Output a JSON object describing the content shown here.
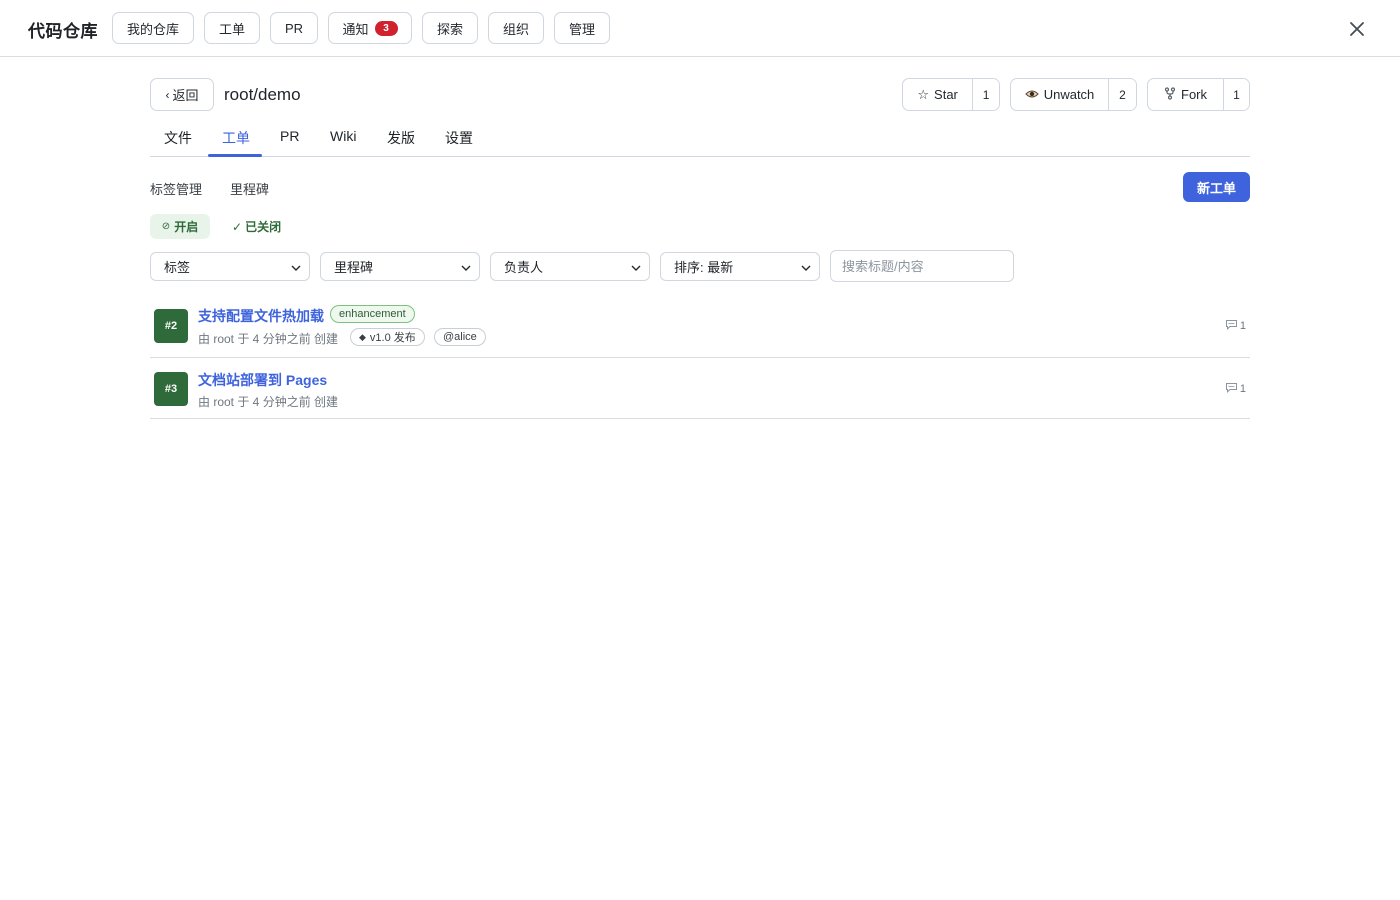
{
  "app": {
    "brand": "代码仓库",
    "nav": [
      {
        "label": "我的仓库"
      },
      {
        "label": "工单"
      },
      {
        "label": "PR"
      },
      {
        "label": "通知",
        "badge": "3"
      },
      {
        "label": "探索"
      },
      {
        "label": "组织"
      },
      {
        "label": "管理"
      }
    ]
  },
  "repo": {
    "back_label": "返回",
    "title": "root/demo",
    "star": {
      "label": "Star",
      "count": "1"
    },
    "watch": {
      "label": "Unwatch",
      "count": "2"
    },
    "fork": {
      "label": "Fork",
      "count": "1"
    }
  },
  "tabs": [
    {
      "label": "文件"
    },
    {
      "label": "工单",
      "active": true
    },
    {
      "label": "PR"
    },
    {
      "label": "Wiki"
    },
    {
      "label": "发版"
    },
    {
      "label": "设置"
    }
  ],
  "subnav": {
    "labels_link": "标签管理",
    "milestones_link": "里程碑",
    "new_issue": "新工单"
  },
  "state_filter": {
    "open": "开启",
    "closed": "已关闭"
  },
  "filters": {
    "label": "标签",
    "milestone": "里程碑",
    "assignee": "负责人",
    "sort": "排序: 最新",
    "search_placeholder": "搜索标题/内容"
  },
  "issues": [
    {
      "number": "#2",
      "title": "支持配置文件热加载",
      "label": "enhancement",
      "meta": "由 root 于 4 分钟之前 创建",
      "milestone": "v1.0 发布",
      "assignee": "@alice",
      "comments": "1"
    },
    {
      "number": "#3",
      "title": "文档站部署到 Pages",
      "meta": "由 root 于 4 分钟之前 创建",
      "comments": "1"
    }
  ],
  "colors": {
    "accent": "#3e63dd",
    "issue_open": "#2f6b3a",
    "badge": "#cf222e"
  }
}
